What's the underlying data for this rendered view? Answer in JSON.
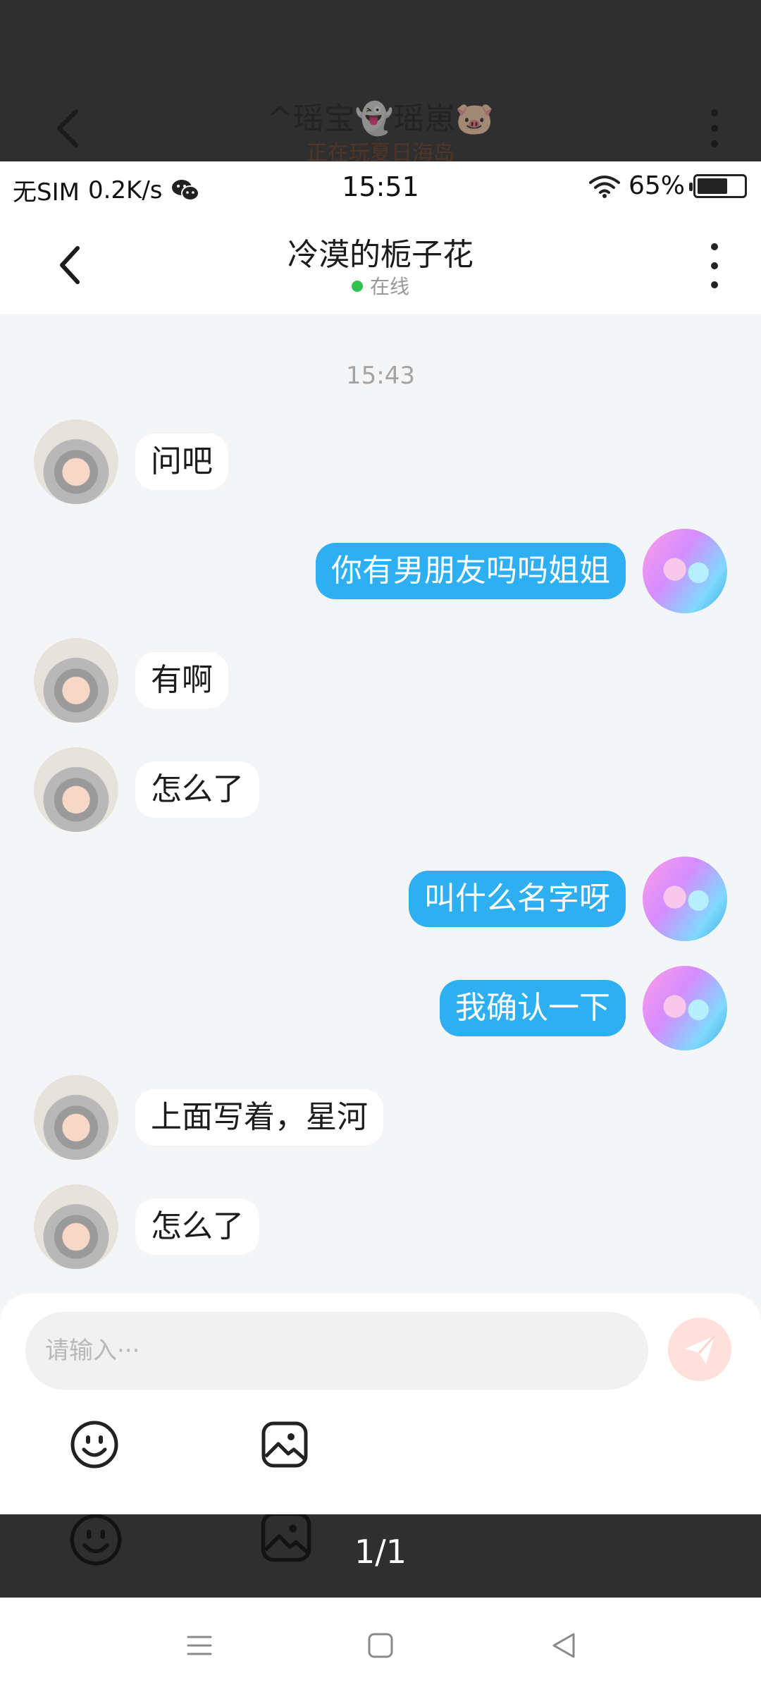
{
  "ghost_header": {
    "title": "^瑶宝👻瑶崽🐷",
    "subtitle": "正在玩夏日海岛"
  },
  "status_bar": {
    "carrier": "无SIM",
    "speed": "0.2K/s",
    "time": "15:51",
    "battery": "65%",
    "battery_level": 0.65,
    "icons": [
      "wechat-icon",
      "wifi-icon",
      "battery-icon"
    ]
  },
  "header": {
    "title": "冷漠的栀子花",
    "status": "在线",
    "status_color": "#2fc24e"
  },
  "chat": {
    "timestamp": "15:43",
    "messages": [
      {
        "side": "in",
        "text": "问吧"
      },
      {
        "side": "out",
        "text": "你有男朋友吗吗姐姐"
      },
      {
        "side": "in",
        "text": "有啊"
      },
      {
        "side": "in",
        "text": "怎么了"
      },
      {
        "side": "out",
        "text": "叫什么名字呀"
      },
      {
        "side": "out",
        "text": "我确认一下"
      },
      {
        "side": "in",
        "text": "上面写着，星河"
      },
      {
        "side": "in",
        "text": "怎么了"
      }
    ],
    "outgoing_bubble_color": "#2daff2",
    "incoming_bubble_color": "#ffffff"
  },
  "input": {
    "placeholder": "请输入···"
  },
  "toolbar": {
    "items": [
      "emoji-icon",
      "image-icon"
    ]
  },
  "pager": {
    "text": "1/1"
  },
  "nav": {
    "items": [
      "menu-icon",
      "home-icon",
      "back-icon"
    ]
  }
}
